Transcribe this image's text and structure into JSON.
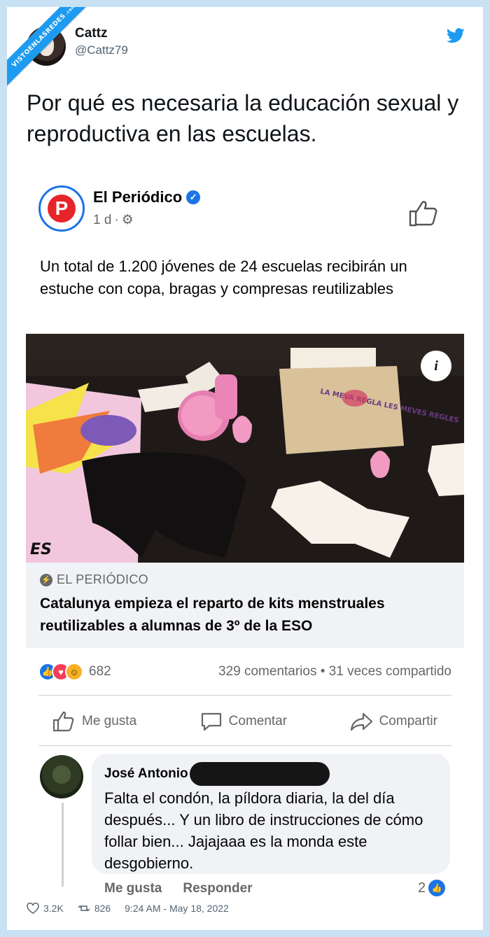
{
  "watermark": {
    "text": "VISTOENLASREDES",
    "suffix": ".com"
  },
  "tweet": {
    "name": "Cattz",
    "handle": "@Cattz79",
    "text": "Por qué es necesaria la educación sexual y reproductiva en las escuelas.",
    "likes": "3.2K",
    "retweets": "826",
    "timestamp": "9:24 AM - May 18, 2022"
  },
  "fb_post": {
    "page_name": "El Periódico",
    "logo_letter": "P",
    "time": "1 d",
    "text": "Un total de 1.200 jóvenes de 24 escuelas recibirán un estuche con copa, bragas y compresas reutilizables",
    "photo_bag_text": "LA MEVA REGLA LES MEVES REGLES",
    "photo_poster_text": "ES",
    "link_source": "EL PERIÓDICO",
    "link_headline": "Catalunya empieza el reparto de kits menstruales reutilizables a alumnas de 3º de la ESO",
    "reactions_count": "682",
    "comments_shares": "329 comentarios • 31 veces compartido",
    "actions": {
      "like": "Me gusta",
      "comment": "Comentar",
      "share": "Compartir"
    }
  },
  "comment": {
    "author": "José Antonio",
    "text": "Falta el condón, la píldora diaria, la del día después... Y un libro de instrucciones de cómo follar bien... Jajajaaa es la monda este desgobierno.",
    "like_label": "Me gusta",
    "reply_label": "Responder",
    "like_count": "2"
  },
  "colors": {
    "background": "#c8e2f3",
    "twitter_blue": "#1d9bf0",
    "facebook_blue": "#1b74e4",
    "periodico_red": "#e6252a"
  }
}
